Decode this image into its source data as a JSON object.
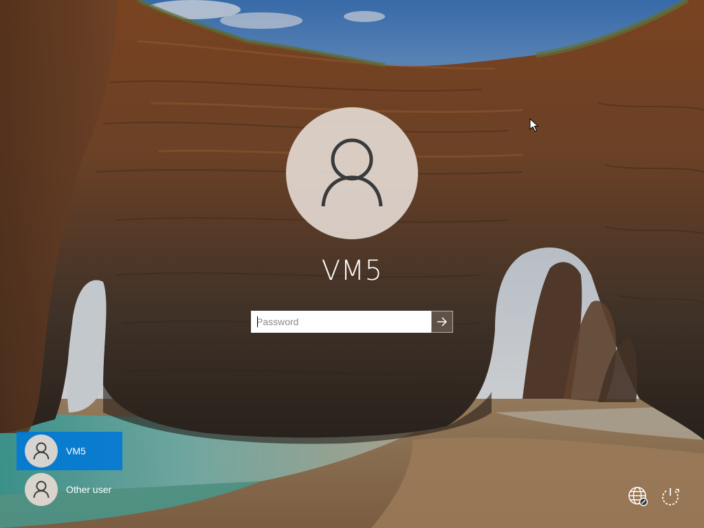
{
  "lock_screen": {
    "current_user": "VM5",
    "password_placeholder": "Password"
  },
  "user_list": [
    {
      "name": "VM5",
      "selected": true
    },
    {
      "name": "Other user",
      "selected": false
    }
  ],
  "corner_controls": {
    "network_icon": "globe-network-icon",
    "power_icon": "power-icon"
  },
  "colors": {
    "selected_user_bg": "#0078D7",
    "avatar_bg": "#E2D8D0"
  }
}
